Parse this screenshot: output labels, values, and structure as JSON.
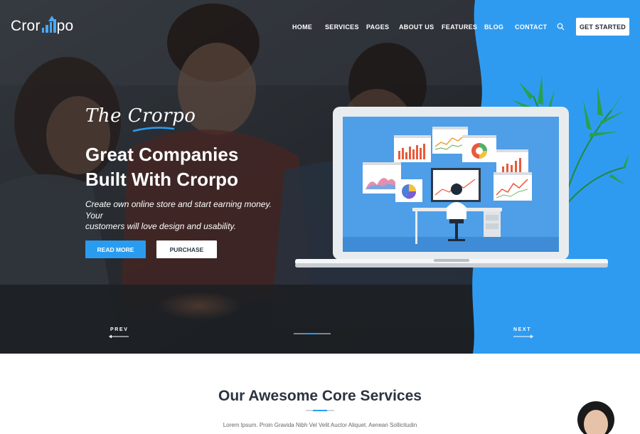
{
  "brand": {
    "logo_before": "Cror",
    "logo_after": "po"
  },
  "nav": {
    "items": [
      {
        "label": "HOME"
      },
      {
        "label": "SERVICES"
      },
      {
        "label": "PAGES"
      },
      {
        "label": "ABOUT US"
      },
      {
        "label": "FEATURES"
      },
      {
        "label": "BLOG"
      },
      {
        "label": "CONTACT"
      }
    ],
    "cta_label": "GET STARTED"
  },
  "hero": {
    "script_title": "The Crorpo",
    "headline_line1": "Great Companies",
    "headline_line2": "Built With Crorpo",
    "subtitle_line1": "Create own online store and start earning money. Your",
    "subtitle_line2": "customers will love design and usability.",
    "primary_button": "READ MORE",
    "secondary_button": "PURCHASE",
    "prev_label": "PREV",
    "next_label": "NEXT"
  },
  "services": {
    "title": "Our Awesome Core Services",
    "text": "Lorem Ipsum. Proin Gravida Nibh Vel Velit Auctor Aliquet. Aenean Sollicitudin"
  },
  "colors": {
    "accent": "#2a9cf0",
    "hero_blue": "#2f9bf0",
    "heading": "#2c3440"
  },
  "icons": [
    "search-icon",
    "logo-bars-icon",
    "arrow-left-icon",
    "arrow-right-icon",
    "plant-icon"
  ]
}
